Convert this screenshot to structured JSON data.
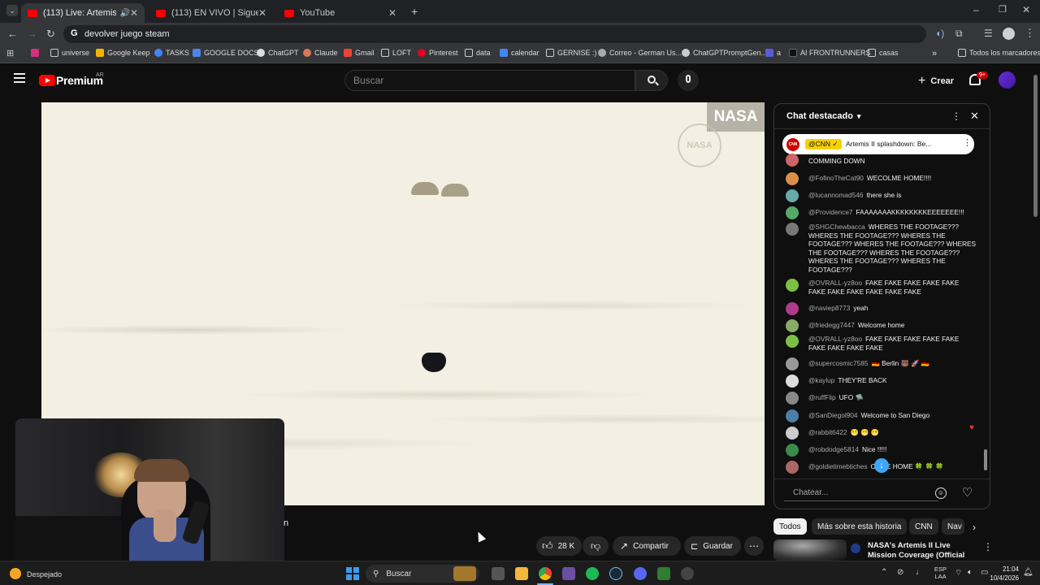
{
  "browser": {
    "tabs": [
      {
        "title": "(113) Live: Artemis II landin"
      },
      {
        "title": "(113) EN VIVO | Sigue el regreso"
      },
      {
        "title": "YouTube"
      }
    ],
    "address": "devolver juego steam",
    "bookmarks": [
      "universe",
      "Google Keep",
      "TASKS",
      "GOOGLE DOCS",
      "ChatGPT",
      "Claude",
      "Gmail",
      "LOFT",
      "Pinterest",
      "data",
      "calendar",
      "GERNISE :)",
      "Correo - German Us...",
      "ChatGPTPromptGen...",
      "a",
      "AI FRONTRUNNERS",
      "casas"
    ],
    "bookmarks_right": "Todos los marcadores"
  },
  "yt": {
    "logo": "Premium",
    "region": "AR",
    "search_placeholder": "Buscar",
    "create_label": "Crear",
    "notif_count": "9+"
  },
  "video": {
    "watermark": "NASA",
    "seal": "NASA"
  },
  "chat": {
    "title": "Chat destacado",
    "pinned_author": "@CNN",
    "pinned_text": "Artemis II splashdown: Be...",
    "input_placeholder": "Chatear...",
    "messages": [
      {
        "author": "",
        "text": "COMMING DOWN",
        "color": "#c66"
      },
      {
        "author": "@FofinoTheCat90",
        "text": "WECOLME HOME!!!!",
        "color": "#d9904a"
      },
      {
        "author": "@lucannomad546",
        "text": "there she is",
        "color": "#6aa"
      },
      {
        "author": "@Providence7",
        "text": "FAAAAAAAKKKKKKKKEEEEEEE!!!",
        "color": "#5a6"
      },
      {
        "author": "@SHGChewbacca",
        "text": "WHERES THE FOOTAGE??? WHERES THE FOOTAGE??? WHERES THE FOOTAGE??? WHERES THE FOOTAGE??? WHERES THE FOOTAGE??? WHERES THE FOOTAGE??? WHERES THE FOOTAGE??? WHERES THE FOOTAGE???",
        "color": "#777"
      },
      {
        "author": "@OVRALL-yz8oo",
        "text": "FAKE FAKE FAKE FAKE FAKE FAKE FAKE FAKE FAKE FAKE FAKE",
        "color": "#7bc043"
      },
      {
        "author": "@naviep8773",
        "text": "yeah",
        "color": "#b03a8a"
      },
      {
        "author": "@friedegg7447",
        "text": "Welcome home",
        "color": "#8a6"
      },
      {
        "author": "@OVRALL-yz8oo",
        "text": "FAKE FAKE FAKE FAKE FAKE FAKE FAKE FAKE FAKE",
        "color": "#7bc043"
      },
      {
        "author": "@supercosmic7585",
        "text": "🇩🇪 Berlin 🐻 🚀 🇩🇪",
        "color": "#999"
      },
      {
        "author": "@kaylup",
        "text": "THEY'RE BACK",
        "color": "#ddd"
      },
      {
        "author": "@ruffFlip",
        "text": "UFO 🛸",
        "color": "#888"
      },
      {
        "author": "@SanDiegol904",
        "text": "Welcome to San Diego",
        "color": "#4a7fa8"
      },
      {
        "author": "@rabbit6422",
        "text": "😁 😁 😁",
        "color": "#ccc"
      },
      {
        "author": "@robdodge5814",
        "text": "Nice !!!!!",
        "color": "#3a8a4a"
      },
      {
        "author": "@goldietimebtiches",
        "text": "COME HOME 🍀 🍀 🍀",
        "color": "#a66"
      }
    ]
  },
  "actions": {
    "likes": "28 K",
    "share": "Compartir",
    "save": "Guardar"
  },
  "chips": [
    "Todos",
    "Más sobre esta historia",
    "CNN",
    "Nav"
  ],
  "recommended": {
    "title": "NASA's Artemis II Live Mission Coverage (Official Broadcast)"
  },
  "taskbar": {
    "weather": "Despejado",
    "search": "Buscar",
    "lang": "ESP",
    "lang2": "LAA",
    "time": "21:04",
    "date": "10/4/2026"
  }
}
